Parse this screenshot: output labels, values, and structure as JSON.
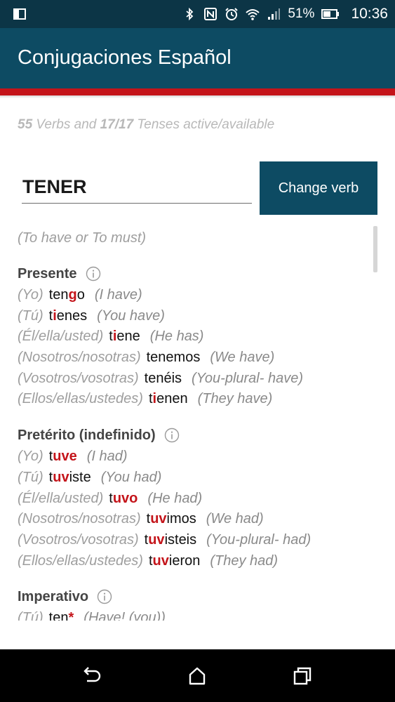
{
  "status_bar": {
    "battery_pct": "51%",
    "time": "10:36",
    "icons": [
      "screen-mirror-icon",
      "bluetooth-icon",
      "nfc-icon",
      "alarm-icon",
      "wifi-icon",
      "signal-icon",
      "battery-icon"
    ]
  },
  "app_bar": {
    "title": "Conjugaciones Español",
    "accent_color": "#c4141a",
    "brand_color": "#0d4b63"
  },
  "summary": {
    "verbs_count": "55",
    "verbs_text": " Verbs and ",
    "tenses_count": "17/17",
    "tenses_text": " Tenses active/available"
  },
  "verb_input": {
    "value": "TENER"
  },
  "change_button": {
    "label": "Change verb"
  },
  "verb_translation": "(To have or To must)",
  "tenses": [
    {
      "name": "Presente",
      "rows": [
        {
          "pronoun": "(Yo)",
          "pre": "ten",
          "irr": "g",
          "post": "o",
          "translation": "(I have)"
        },
        {
          "pronoun": "(Tú)",
          "pre": "t",
          "irr": "i",
          "post": "enes",
          "translation": "(You have)"
        },
        {
          "pronoun": "(Él/ella/usted)",
          "pre": "t",
          "irr": "i",
          "post": "ene",
          "translation": "(He has)"
        },
        {
          "pronoun": "(Nosotros/nosotras)",
          "pre": "tenemos",
          "irr": "",
          "post": "",
          "translation": "(We have)"
        },
        {
          "pronoun": "(Vosotros/vosotras)",
          "pre": "tenéis",
          "irr": "",
          "post": "",
          "translation": "(You-plural- have)"
        },
        {
          "pronoun": "(Ellos/ellas/ustedes)",
          "pre": "t",
          "irr": "i",
          "post": "enen",
          "translation": "(They have)"
        }
      ]
    },
    {
      "name": "Pretérito (indefinido)",
      "rows": [
        {
          "pronoun": "(Yo)",
          "pre": "t",
          "irr": "uve",
          "post": "",
          "translation": "(I had)"
        },
        {
          "pronoun": "(Tú)",
          "pre": "t",
          "irr": "uv",
          "post": "iste",
          "translation": "(You had)"
        },
        {
          "pronoun": "(Él/ella/usted)",
          "pre": "t",
          "irr": "uvo",
          "post": "",
          "translation": "(He had)"
        },
        {
          "pronoun": "(Nosotros/nosotras)",
          "pre": "t",
          "irr": "uv",
          "post": "imos",
          "translation": "(We had)"
        },
        {
          "pronoun": "(Vosotros/vosotras)",
          "pre": "t",
          "irr": "uv",
          "post": "isteis",
          "translation": "(You-plural- had)"
        },
        {
          "pronoun": "(Ellos/ellas/ustedes)",
          "pre": "t",
          "irr": "uv",
          "post": "ieron",
          "translation": "(They had)"
        }
      ]
    },
    {
      "name": "Imperativo",
      "rows": [
        {
          "pronoun": "(Tú)",
          "pre": "ten",
          "irr": "*",
          "post": "",
          "translation": "(Have! (you))"
        }
      ]
    }
  ],
  "nav_bar": {
    "icons": [
      "back-icon",
      "home-icon",
      "recents-icon"
    ]
  }
}
